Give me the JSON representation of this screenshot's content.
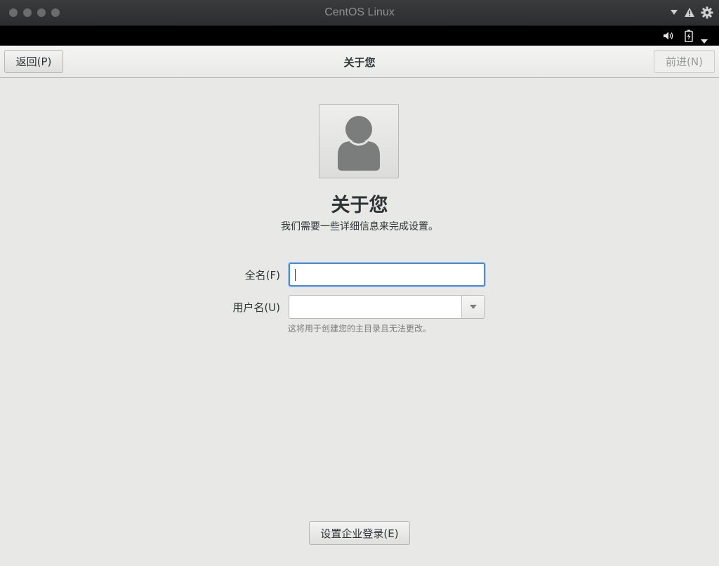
{
  "window": {
    "title": "CentOS Linux",
    "icons": [
      "close-dot",
      "minimize-dot",
      "zoom-dot",
      "extra-dot",
      "dropdown-arrow",
      "warning",
      "gear"
    ]
  },
  "system_bar": {
    "icons": [
      "volume-icon",
      "battery-icon",
      "system-menu-arrow"
    ]
  },
  "header": {
    "back_label": "返回(P)",
    "title": "关于您",
    "next_label": "前进(N)",
    "next_disabled": true
  },
  "main": {
    "heading": "关于您",
    "subtitle": "我们需要一些详细信息来完成设置。",
    "fullname_label": "全名(F)",
    "fullname_value": "",
    "username_label": "用户名(U)",
    "username_value": "",
    "username_hint": "这将用于创建您的主目录且无法更改。",
    "enterprise_button": "设置企业登录(E)"
  },
  "colors": {
    "accent": "#4a90d9",
    "background": "#e8e8e7",
    "text": "#2e3436"
  }
}
